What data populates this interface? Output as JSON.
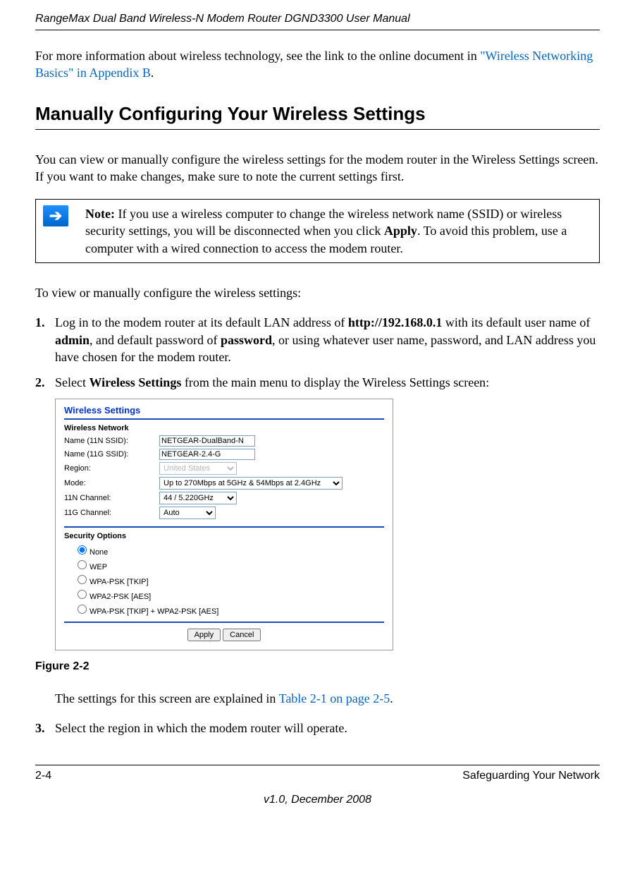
{
  "header": {
    "title": "RangeMax Dual Band Wireless-N Modem Router DGND3300 User Manual"
  },
  "intro": {
    "text_before_link": "For more information about wireless technology, see the link to the online document in ",
    "link": "\"Wireless Networking Basics\" in Appendix B",
    "text_after_link": "."
  },
  "section": {
    "heading": "Manually Configuring Your Wireless Settings",
    "body": "You can view or manually configure the wireless settings for the modem router in the Wireless Settings screen. If you want to make changes, make sure to note the current settings first."
  },
  "note": {
    "label": "Note:",
    "text_1": " If you use a wireless computer to change the wireless network name (SSID) or wireless security settings, you will be disconnected when you click ",
    "apply": "Apply",
    "text_2": ". To avoid this problem, use a computer with a wired connection to access the modem router."
  },
  "instructions_intro": "To view or manually configure the wireless settings:",
  "steps": {
    "s1": {
      "num": "1.",
      "t1": "Log in to the modem router at its default LAN address of ",
      "url": "http://192.168.0.1",
      "t2": " with its default user name of ",
      "admin": "admin",
      "t3": ", and default password of ",
      "password": "password",
      "t4": ", or using whatever user name, password, and LAN address you have chosen for the modem router."
    },
    "s2": {
      "num": "2.",
      "t1": "Select ",
      "ws": "Wireless Settings",
      "t2": " from the main menu to display the Wireless Settings screen:"
    },
    "s3": {
      "num": "3.",
      "text": "Select the region in which the modem router will operate."
    }
  },
  "screenshot": {
    "title": "Wireless Settings",
    "section_network": "Wireless Network",
    "labels": {
      "name_11n": "Name (11N SSID):",
      "name_11g": "Name (11G SSID):",
      "region": "Region:",
      "mode": "Mode:",
      "ch_11n": "11N Channel:",
      "ch_11g": "11G Channel:"
    },
    "values": {
      "name_11n": "NETGEAR-DualBand-N",
      "name_11g": "NETGEAR-2.4-G",
      "region": "United States",
      "mode": "Up to 270Mbps at 5GHz & 54Mbps at 2.4GHz",
      "ch_11n": "44 / 5.220GHz",
      "ch_11g": "Auto"
    },
    "section_security": "Security Options",
    "security_options": {
      "none": "None",
      "wep": "WEP",
      "wpa_psk": "WPA-PSK [TKIP]",
      "wpa2_psk": "WPA2-PSK [AES]",
      "wpa_both": "WPA-PSK [TKIP] + WPA2-PSK [AES]"
    },
    "buttons": {
      "apply": "Apply",
      "cancel": "Cancel"
    }
  },
  "figure_caption": "Figure 2-2",
  "explanation": {
    "t1": "The settings for this screen are explained in ",
    "link": "Table 2-1 on page 2-5",
    "t2": "."
  },
  "footer": {
    "page": "2-4",
    "right": "Safeguarding Your Network",
    "version": "v1.0, December 2008"
  }
}
